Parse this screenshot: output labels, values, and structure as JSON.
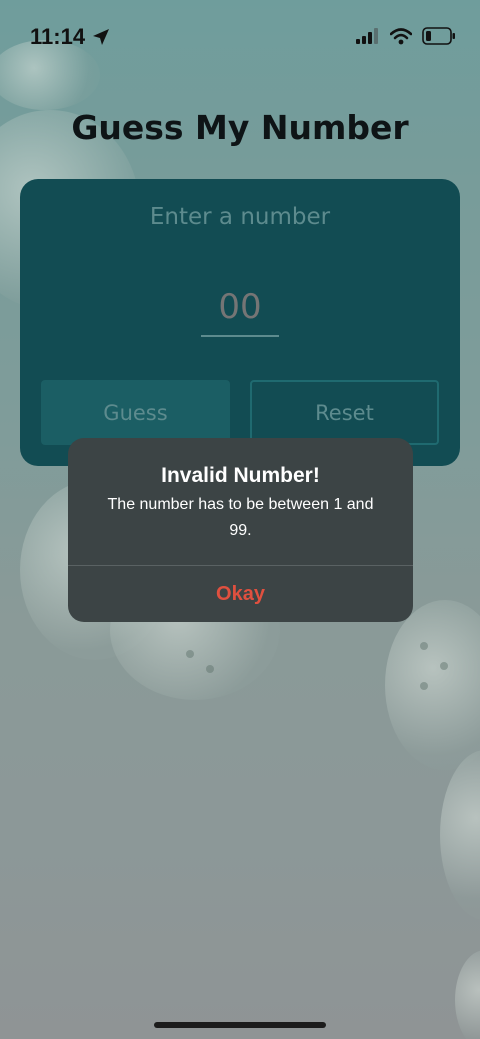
{
  "status_bar": {
    "time": "11:14",
    "icons": [
      "location-arrow-icon",
      "signal-icon",
      "wifi-icon",
      "battery-icon"
    ]
  },
  "title": "Guess My Number",
  "card": {
    "label": "Enter a number",
    "input_placeholder": "00",
    "guess_label": "Guess",
    "reset_label": "Reset"
  },
  "alert": {
    "title": "Invalid Number!",
    "message": "The number has to be between 1 and 99.",
    "button_label": "Okay"
  },
  "colors": {
    "card": "#124c53",
    "alert_bg": "#3c4445",
    "alert_button": "#e0503f"
  }
}
